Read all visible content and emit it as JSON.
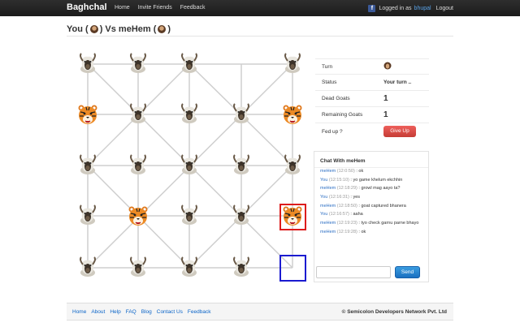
{
  "brand": "Baghchal",
  "nav": [
    "Home",
    "Invite Friends",
    "Feedback"
  ],
  "login": {
    "prefix": "Logged in as",
    "user": "bhupal",
    "logout": "Logout",
    "icon": "facebook-icon"
  },
  "header": {
    "you": "You (",
    "mid": ") Vs meHem (",
    "end": ")"
  },
  "board": {
    "rows": [
      [
        "goat",
        "goat",
        "goat",
        "empty",
        "goat"
      ],
      [
        "tiger",
        "goat",
        "goat",
        "goat",
        "tiger"
      ],
      [
        "goat",
        "goat",
        "goat",
        "goat",
        "goat"
      ],
      [
        "goat",
        "tiger",
        "goat",
        "goat",
        "tiger"
      ],
      [
        "goat",
        "goat",
        "goat",
        "goat",
        "empty"
      ]
    ],
    "highlight_selected": "red",
    "highlight_target": "blue",
    "line_color": "#cfcfcf"
  },
  "info": {
    "turn_label": "Turn",
    "status_label": "Status",
    "status_value": "Your turn ..",
    "dead_label": "Dead Goats",
    "dead_value": "1",
    "remaining_label": "Remaining Goats",
    "remaining_value": "1",
    "fedup_label": "Fed up ?",
    "giveup_label": "Give Up"
  },
  "chat": {
    "title": "Chat With meHem",
    "messages": [
      {
        "who": "meHem",
        "time": "(12:0:50)",
        "text": ": ok"
      },
      {
        "who": "You",
        "time": "(12:15:10)",
        "text": ": yo game khelum ekchhin"
      },
      {
        "who": "meHem",
        "time": "(12:18:29)",
        "text": ": growl mag aayo ta?"
      },
      {
        "who": "You",
        "time": "(12:16:31)",
        "text": ": yes"
      },
      {
        "who": "meHem",
        "time": "(12:18:50)",
        "text": ": goat captured bhanera"
      },
      {
        "who": "You",
        "time": "(12:16:57)",
        "text": ": aaha"
      },
      {
        "who": "meHem",
        "time": "(12:19:23)",
        "text": ": tyo check garnu parne bhayo"
      },
      {
        "who": "meHem",
        "time": "(12:19:28)",
        "text": ": ok"
      }
    ],
    "send_label": "Send"
  },
  "footer": {
    "links": [
      "Home",
      "About",
      "Help",
      "FAQ",
      "Blog",
      "Contact Us",
      "Feedback"
    ],
    "copyright": "© Semicolon Developers Network Pvt. Ltd"
  }
}
